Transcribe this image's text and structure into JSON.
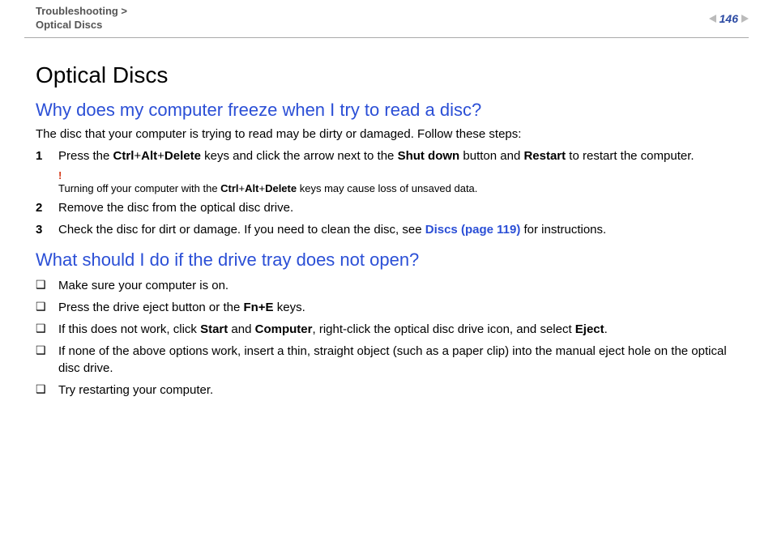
{
  "breadcrumb": {
    "line1": "Troubleshooting >",
    "line2": "Optical Discs"
  },
  "page_number": "146",
  "title": "Optical Discs",
  "section1": {
    "heading": "Why does my computer freeze when I try to read a disc?",
    "intro": "The disc that your computer is trying to read may be dirty or damaged. Follow these steps:",
    "steps": [
      {
        "num": "1",
        "parts": {
          "t1": "Press the ",
          "b1": "Ctrl",
          "plus1": "+",
          "b2": "Alt",
          "plus2": "+",
          "b3": "Delete",
          "t2": " keys and click the arrow next to the ",
          "b4": "Shut down",
          "t3": " button and ",
          "b5": "Restart",
          "t4": " to restart the computer."
        },
        "warning": {
          "mark": "!",
          "pre": "Turning off your computer with the ",
          "b1": "Ctrl",
          "plus1": "+",
          "b2": "Alt",
          "plus2": "+",
          "b3": "Delete",
          "post": " keys may cause loss of unsaved data."
        }
      },
      {
        "num": "2",
        "text": "Remove the disc from the optical disc drive."
      },
      {
        "num": "3",
        "parts": {
          "t1": "Check the disc for dirt or damage. If you need to clean the disc, see ",
          "link": "Discs (page 119)",
          "t2": " for instructions."
        }
      }
    ]
  },
  "section2": {
    "heading": "What should I do if the drive tray does not open?",
    "bullets": [
      {
        "text": "Make sure your computer is on."
      },
      {
        "parts": {
          "t1": "Press the drive eject button or the ",
          "b1": "Fn+E",
          "t2": " keys."
        }
      },
      {
        "parts": {
          "t1": "If this does not work, click ",
          "b1": "Start",
          "t2": " and ",
          "b2": "Computer",
          "t3": ", right-click the optical disc drive icon, and select ",
          "b3": "Eject",
          "t4": "."
        }
      },
      {
        "text": "If none of the above options work, insert a thin, straight object (such as a paper clip) into the manual eject hole on the optical disc drive."
      },
      {
        "text": "Try restarting your computer."
      }
    ]
  },
  "bullet_glyph": "❑"
}
